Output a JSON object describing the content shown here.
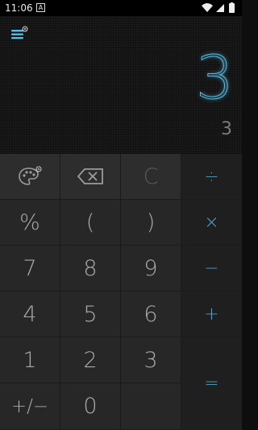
{
  "status_bar": {
    "time": "11:06",
    "notification_icon": "A"
  },
  "display": {
    "result": "3",
    "expression": "3"
  },
  "keypad": {
    "top_row": {
      "theme_icon": "palette-icon",
      "backspace_icon": "backspace-icon",
      "clear": "C"
    },
    "operators": {
      "divide": "÷",
      "multiply": "×",
      "minus": "−",
      "plus": "+",
      "equals": "="
    },
    "row_percent": [
      "%",
      "(",
      ")"
    ],
    "row_7": [
      "7",
      "8",
      "9"
    ],
    "row_4": [
      "4",
      "5",
      "6"
    ],
    "row_1": [
      "1",
      "2",
      "3"
    ],
    "bottom": {
      "sign": "+/−",
      "zero": "0"
    }
  },
  "colors": {
    "accent": "#58bde6",
    "operator": "#4ea3c8",
    "key_text": "#a9a9a9"
  }
}
